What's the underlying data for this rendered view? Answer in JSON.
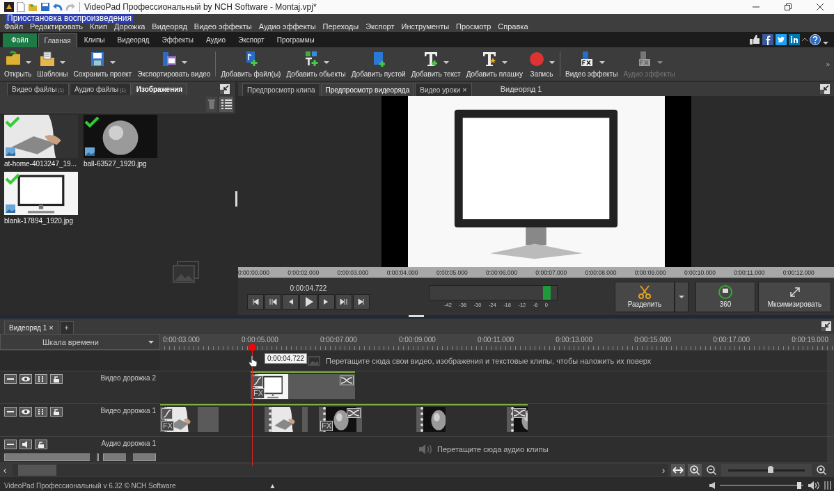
{
  "window": {
    "title": "VideoPad Профессиональный by NCH Software - Montaj.vpj*",
    "tooltip": "Приостановка воспроизведения"
  },
  "menu": [
    "Файл",
    "Редактировать",
    "Клип",
    "Дорожка",
    "Видеоряд",
    "Видео эффекты",
    "Аудио эффекты",
    "Переходы",
    "Экспорт",
    "Инструменты",
    "Просмотр",
    "Справка"
  ],
  "ribbon_tabs": [
    {
      "label": "Файл",
      "kind": "file",
      "selected": false
    },
    {
      "label": "Главная",
      "kind": "tab",
      "selected": true
    },
    {
      "label": "Клипы",
      "kind": "tab",
      "selected": false
    },
    {
      "label": "Видеоряд",
      "kind": "tab",
      "selected": false
    },
    {
      "label": "Эффекты",
      "kind": "tab",
      "selected": false
    },
    {
      "label": "Аудио",
      "kind": "tab",
      "selected": false
    },
    {
      "label": "Экспорт",
      "kind": "tab",
      "selected": false
    },
    {
      "label": "Программы",
      "kind": "tab",
      "selected": false
    }
  ],
  "toolbar": {
    "items": [
      {
        "label": "Открыть",
        "dropdown": true,
        "disabled": false
      },
      {
        "label": "Шаблоны",
        "dropdown": true,
        "disabled": false
      },
      {
        "label": "Сохранить проект",
        "dropdown": true,
        "disabled": false
      },
      {
        "label": "Экспортировать видео",
        "dropdown": true,
        "disabled": false
      },
      {
        "label": "Добавить файл(ы)",
        "dropdown": false,
        "disabled": false
      },
      {
        "label": "Добавить обьекты",
        "dropdown": true,
        "disabled": false
      },
      {
        "label": "Добавить пустой",
        "dropdown": false,
        "disabled": false
      },
      {
        "label": "Добавить текст",
        "dropdown": true,
        "disabled": false
      },
      {
        "label": "Добавить плашку",
        "dropdown": true,
        "disabled": false
      },
      {
        "label": "Запись",
        "dropdown": true,
        "disabled": false
      },
      {
        "label": "Видео эффекты",
        "dropdown": true,
        "disabled": false
      },
      {
        "label": "Аудио эффекты",
        "dropdown": true,
        "disabled": true
      }
    ],
    "overflow": "»"
  },
  "media_panel": {
    "tabs": [
      {
        "label": "Видео файлы",
        "count": "(1)",
        "selected": false
      },
      {
        "label": "Аудио файлы",
        "count": "(1)",
        "selected": false
      },
      {
        "label": "Изображения",
        "selected": true
      }
    ],
    "items": [
      {
        "name": "at-home-4013247_19...",
        "kind": "photo",
        "checked": true
      },
      {
        "name": "ball-63527_1920.jpg",
        "kind": "ball",
        "checked": true
      },
      {
        "name": "blank-17894_1920.jpg",
        "kind": "monitor",
        "checked": true
      }
    ]
  },
  "preview": {
    "tabs": [
      {
        "label": "Предпросмотр клипа",
        "selected": false
      },
      {
        "label": "Предпросмотр видеоряда",
        "selected": true
      },
      {
        "label": "Видео уроки",
        "close": "×",
        "selected": false
      }
    ],
    "title": "Видеоряд 1",
    "ruler": [
      "0:00:00.000",
      "0:00:02.000",
      "0:00:03.000",
      "0:00:04.000",
      "0:00:05.000",
      "0:00:06.000",
      "0:00:07.000",
      "0:00:08.000",
      "0:00:09.000",
      "0:00:10.000",
      "0:00:11.000",
      "0:00:12.000"
    ],
    "time": "0:00:04.722",
    "meter_scale": [
      "-42",
      "-36",
      "-30",
      "-24",
      "-18",
      "-12",
      "-6",
      "0"
    ],
    "buttons": [
      {
        "label": "Разделить",
        "kind": "split",
        "dropdown": true
      },
      {
        "label": "360",
        "kind": "panorama",
        "dropdown": false
      },
      {
        "label": "Мксимизировать",
        "kind": "maximize",
        "dropdown": false
      }
    ]
  },
  "timeline": {
    "tabs": [
      {
        "label": "Видеоряд 1",
        "close": "×",
        "selected": true
      },
      {
        "label": "+",
        "selected": false
      }
    ],
    "scale_label": "Шкала времени",
    "ruler": [
      "0:00:03.000",
      "0:00:05.000",
      "0:00:07.000",
      "0:00:09.000",
      "0:00:11.000",
      "0:00:13.000",
      "0:00:15.000",
      "0:00:17.000",
      "0:00:19.000"
    ],
    "cursor_time": "0:00:04.722",
    "overlay_hint": "Перетащите сюда свои видео, изображения и текстовые клипы, чтобы наложить их поверх",
    "tracks": [
      {
        "name": "Видео дорожка 2",
        "kind": "video",
        "clips": [
          {
            "kind": "monitor",
            "fade": true,
            "fx": "FX",
            "transition": true
          }
        ]
      },
      {
        "name": "Видео дорожка 1",
        "kind": "video",
        "clips": [
          {
            "kind": "photo",
            "fade": true,
            "fx": "FX",
            "transition": false
          },
          {
            "kind": "photo",
            "fade": false,
            "transition": false
          },
          {
            "kind": "ball",
            "fade": false,
            "fx": "FX",
            "transition": true
          },
          {
            "kind": "ball",
            "fade": false,
            "transition": false
          },
          {
            "kind": "ball",
            "fade": false,
            "transition": true
          }
        ]
      },
      {
        "name": "Аудио дорожка 1",
        "kind": "audio",
        "hint": "Перетащите сюда аудио клипы",
        "volume": {
          "level": 0.95
        },
        "pan": {
          "level": 0.5
        }
      }
    ],
    "scroll_left": "‹",
    "scroll_right": "›",
    "zoom": {
      "level": 0.55
    }
  },
  "status_bar": {
    "text": "VideoPad Профессиональный v 6.32 © NCH Software",
    "toggle": "▲",
    "volume": {
      "level": 0.95
    }
  }
}
